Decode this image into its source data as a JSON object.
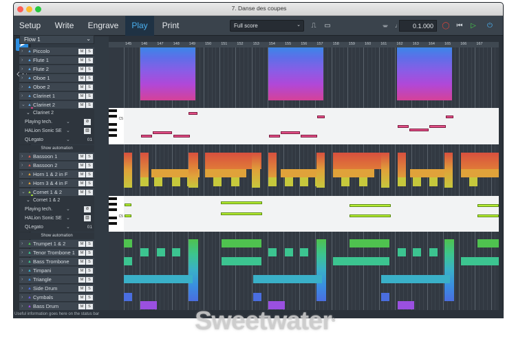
{
  "window": {
    "title": "7. Danse des coupes"
  },
  "modes": [
    {
      "label": "Setup"
    },
    {
      "label": "Write"
    },
    {
      "label": "Engrave"
    },
    {
      "label": "Play"
    },
    {
      "label": "Print"
    }
  ],
  "layout_select": {
    "value": "Full score"
  },
  "transport": {
    "time": "0.1.000"
  },
  "flow": {
    "value": "Flow 1"
  },
  "ruler": {
    "bars": [
      "145",
      "146",
      "147",
      "148",
      "149",
      "150",
      "151",
      "152",
      "153",
      "154",
      "155",
      "156",
      "157",
      "158",
      "159",
      "160",
      "161",
      "162",
      "163",
      "164",
      "165",
      "166",
      "167"
    ]
  },
  "tracks": {
    "piccolo": "Piccolo",
    "flute1": "Flute 1",
    "flute2": "Flute 2",
    "oboe1": "Oboe 1",
    "oboe2": "Oboe 2",
    "clarinet1": "Clarinet 1",
    "clarinet2": "Clarinet 2",
    "bassoon1": "Bassoon 1",
    "bassoon2": "Bassoon 2",
    "horn12": "Horn 1 & 2 in F",
    "horn34": "Horn 3 & 4 in F",
    "cornet12": "Cornet 1 & 2",
    "trumpet12": "Trumpet 1 & 2",
    "tenortrombone": "Tenor Trombone 1",
    "basstrombone": "Bass Trombone",
    "timpani": "Timpani",
    "triangle": "Triangle",
    "sidedrum": "Side Drum",
    "cymbals": "Cymbals",
    "bassdrum": "Bass Drum"
  },
  "clarinet_editor": {
    "title": "Clarinet 2",
    "playing_tech": "Playing tech.",
    "instrument": "HALion Sonic SE",
    "expression": "QLegato",
    "channel": "01",
    "key_label": "C5",
    "show_automation": "Show automation"
  },
  "cornet_editor": {
    "title": "Cornet 1 & 2",
    "playing_tech": "Playing tech.",
    "instrument": "HALion Sonic SE",
    "expression": "QLegato",
    "channel": "01",
    "key_label": "C5",
    "show_automation": "Show automation"
  },
  "mute_label": "M",
  "solo_label": "S",
  "status_bar": {
    "text": "Useful information goes here on the status bar"
  },
  "watermark": {
    "text": "Sweetwater",
    "mark": "®"
  },
  "colors": {
    "accent": "#4ab0f0",
    "selected_tool": "#2c8de0",
    "clarinet_notes": "#e44f88",
    "cornet_notes": "#b8ee35"
  }
}
